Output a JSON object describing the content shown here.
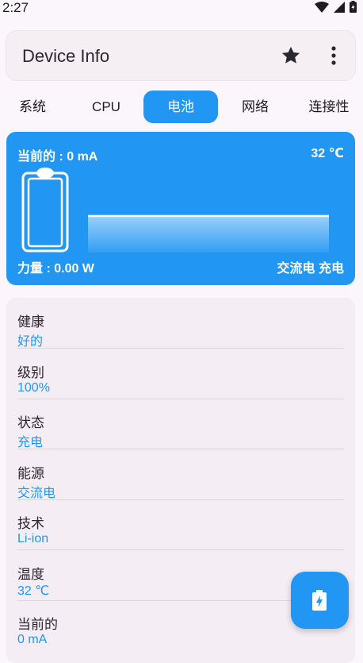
{
  "status_bar": {
    "time": "2:27"
  },
  "app_bar": {
    "title": "Device Info"
  },
  "tabs": [
    {
      "label": "系统",
      "active": false
    },
    {
      "label": "CPU",
      "active": false
    },
    {
      "label": "电池",
      "active": true
    },
    {
      "label": "网络",
      "active": false
    },
    {
      "label": "连接性",
      "active": false
    }
  ],
  "battery_card": {
    "current": "当前的 : 0 mA",
    "temperature": "32 ℃",
    "power": "力量 : 0.00 W",
    "source": "交流电 充电"
  },
  "info": [
    {
      "label": "健康",
      "value": "好的"
    },
    {
      "label": "级别",
      "value": "100%"
    },
    {
      "label": "状态",
      "value": "充电"
    },
    {
      "label": "能源",
      "value": "交流电"
    },
    {
      "label": "技术",
      "value": "Li-ion"
    },
    {
      "label": "温度",
      "value": "32 ℃"
    },
    {
      "label": "当前的",
      "value": "0 mA"
    }
  ],
  "colors": {
    "accent": "#2196f3",
    "background": "#fbf6fb",
    "card": "#f4eef4"
  },
  "icons": [
    "wifi-icon",
    "signal-icon",
    "battery-charging-icon",
    "star-icon",
    "more-vert-icon",
    "battery-outline-icon",
    "battery-bolt-icon"
  ]
}
